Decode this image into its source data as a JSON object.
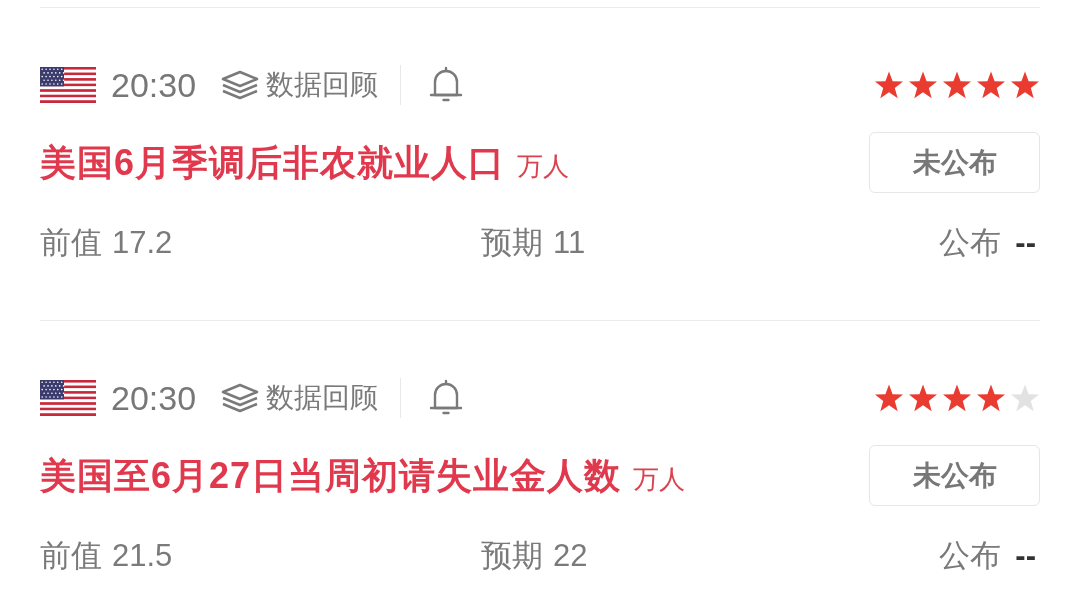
{
  "events": [
    {
      "time": "20:30",
      "review_link": "数据回顾",
      "stars": 5,
      "title": "美国6月季调后非农就业人口",
      "unit": "万人",
      "status_button": "未公布",
      "previous": {
        "label": "前值",
        "value": "17.2"
      },
      "forecast": {
        "label": "预期",
        "value": "11"
      },
      "actual": {
        "label": "公布",
        "value": "--"
      }
    },
    {
      "time": "20:30",
      "review_link": "数据回顾",
      "stars": 4,
      "title": "美国至6月27日当周初请失业金人数",
      "unit": "万人",
      "status_button": "未公布",
      "previous": {
        "label": "前值",
        "value": "21.5"
      },
      "forecast": {
        "label": "预期",
        "value": "22"
      },
      "actual": {
        "label": "公布",
        "value": "--"
      }
    }
  ]
}
